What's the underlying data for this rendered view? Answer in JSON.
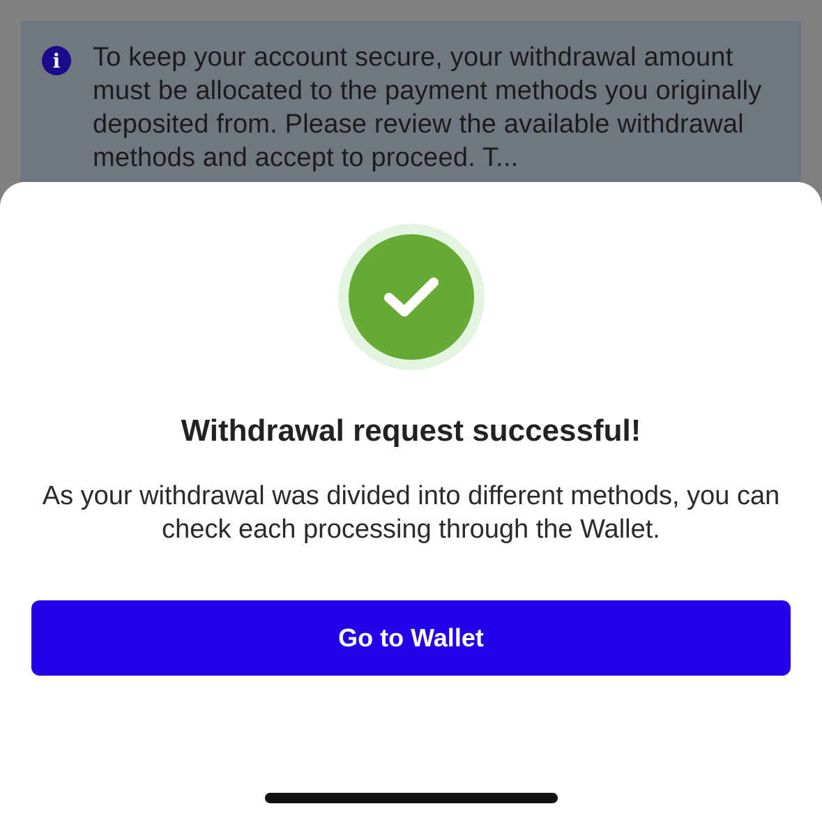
{
  "background": {
    "info_icon_glyph": "i",
    "info_icon_name": "info-icon",
    "info_text": "To keep your account secure, your withdrawal amount must be allocated to the payment methods you originally deposited from. Please review the available withdrawal methods and accept to proceed. T..."
  },
  "sheet": {
    "success_icon_name": "check-icon",
    "title": "Withdrawal request successful!",
    "message": "As your withdrawal was divided into different methods, you can check each processing through the Wallet.",
    "button_label": "Go to Wallet"
  },
  "colors": {
    "accent": "#2200ea",
    "success": "#66aa33",
    "success_ring": "#e3f5e1",
    "info_icon": "#1a0a8c"
  }
}
